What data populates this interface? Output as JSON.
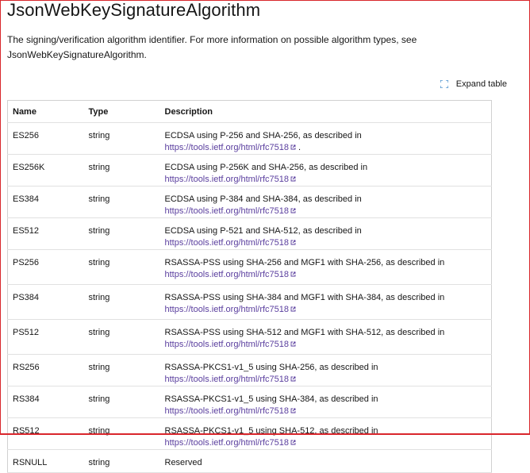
{
  "page": {
    "title": "JsonWebKeySignatureAlgorithm",
    "description": "The signing/verification algorithm identifier. For more information on possible algorithm types, see JsonWebKeySignatureAlgorithm.",
    "expand_label": "Expand table"
  },
  "table": {
    "headers": {
      "name": "Name",
      "type": "Type",
      "description": "Description"
    },
    "rows": [
      {
        "name": "ES256",
        "type": "string",
        "text": "ECDSA using P-256 and SHA-256, as described in ",
        "link": "https://tools.ietf.org/html/rfc7518",
        "suffix": "."
      },
      {
        "name": "ES256K",
        "type": "string",
        "text": "ECDSA using P-256K and SHA-256, as described in ",
        "link": "https://tools.ietf.org/html/rfc7518",
        "suffix": ""
      },
      {
        "name": "ES384",
        "type": "string",
        "text": "ECDSA using P-384 and SHA-384, as described in ",
        "link": "https://tools.ietf.org/html/rfc7518",
        "suffix": ""
      },
      {
        "name": "ES512",
        "type": "string",
        "text": "ECDSA using P-521 and SHA-512, as described in ",
        "link": "https://tools.ietf.org/html/rfc7518",
        "suffix": ""
      },
      {
        "name": "PS256",
        "type": "string",
        "text": "RSASSA-PSS using SHA-256 and MGF1 with SHA-256, as described in",
        "link": "https://tools.ietf.org/html/rfc7518",
        "suffix": "",
        "wrap": true
      },
      {
        "name": "PS384",
        "type": "string",
        "text": "RSASSA-PSS using SHA-384 and MGF1 with SHA-384, as described in",
        "link": "https://tools.ietf.org/html/rfc7518",
        "suffix": "",
        "wrap": true
      },
      {
        "name": "PS512",
        "type": "string",
        "text": "RSASSA-PSS using SHA-512 and MGF1 with SHA-512, as described in",
        "link": "https://tools.ietf.org/html/rfc7518",
        "suffix": "",
        "wrap": true
      },
      {
        "name": "RS256",
        "type": "string",
        "text": "RSASSA-PKCS1-v1_5 using SHA-256, as described in ",
        "link": "https://tools.ietf.org/html/rfc7518",
        "suffix": ""
      },
      {
        "name": "RS384",
        "type": "string",
        "text": "RSASSA-PKCS1-v1_5 using SHA-384, as described in ",
        "link": "https://tools.ietf.org/html/rfc7518",
        "suffix": ""
      },
      {
        "name": "RS512",
        "type": "string",
        "text": "RSASSA-PKCS1-v1_5 using SHA-512, as described in ",
        "link": "https://tools.ietf.org/html/rfc7518",
        "suffix": ""
      },
      {
        "name": "RSNULL",
        "type": "string",
        "text": "Reserved",
        "link": "",
        "suffix": ""
      }
    ]
  },
  "colors": {
    "link": "#5a3e9e",
    "border_accent": "#d9262c"
  },
  "icons": {
    "expand": "expand-icon",
    "external": "external-link-icon"
  }
}
